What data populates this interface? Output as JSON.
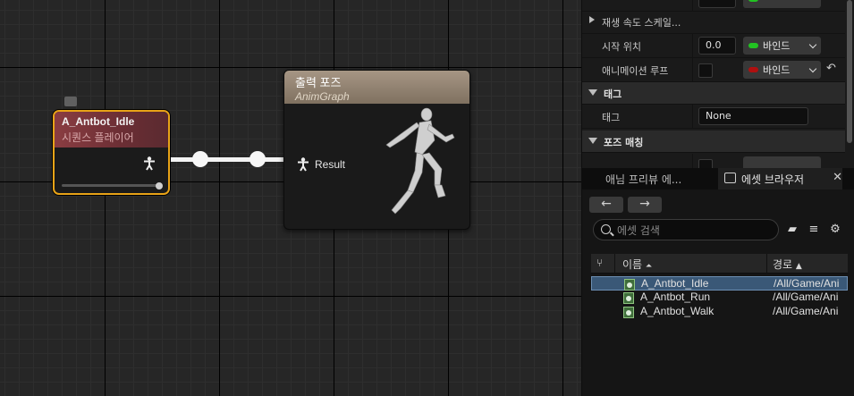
{
  "graph": {
    "sequence_node": {
      "title": "A_Antbot_Idle",
      "subtitle": "시퀀스 플레이어",
      "border_color": "#e8a317"
    },
    "output_node": {
      "title": "출력 포즈",
      "subtitle": "AnimGraph",
      "input_label": "Result"
    }
  },
  "details": {
    "rows": [
      {
        "label": "재생 속도 스케일...",
        "collapsed": true
      },
      {
        "label": "시작 위치",
        "value": "0.0",
        "binding": "바인드",
        "binding_color": "#22c222"
      },
      {
        "label": "애니메이션 루프",
        "binding": "바인드",
        "binding_color": "#b01010"
      }
    ],
    "categories": [
      "태그",
      "포즈 매칭"
    ],
    "tag_row": {
      "label": "태그",
      "value": "None"
    }
  },
  "browser": {
    "tabs": [
      "애님 프리뷰 에...",
      "에셋 브라우저"
    ],
    "search_placeholder": "에셋 검색",
    "columns": {
      "name": "이름",
      "path": "경로"
    },
    "assets": [
      {
        "name": "A_Antbot_Idle",
        "path": "/All/Game/Ani",
        "selected": true
      },
      {
        "name": "A_Antbot_Run",
        "path": "/All/Game/Ani",
        "selected": false
      },
      {
        "name": "A_Antbot_Walk",
        "path": "/All/Game/Ani",
        "selected": false
      }
    ]
  }
}
